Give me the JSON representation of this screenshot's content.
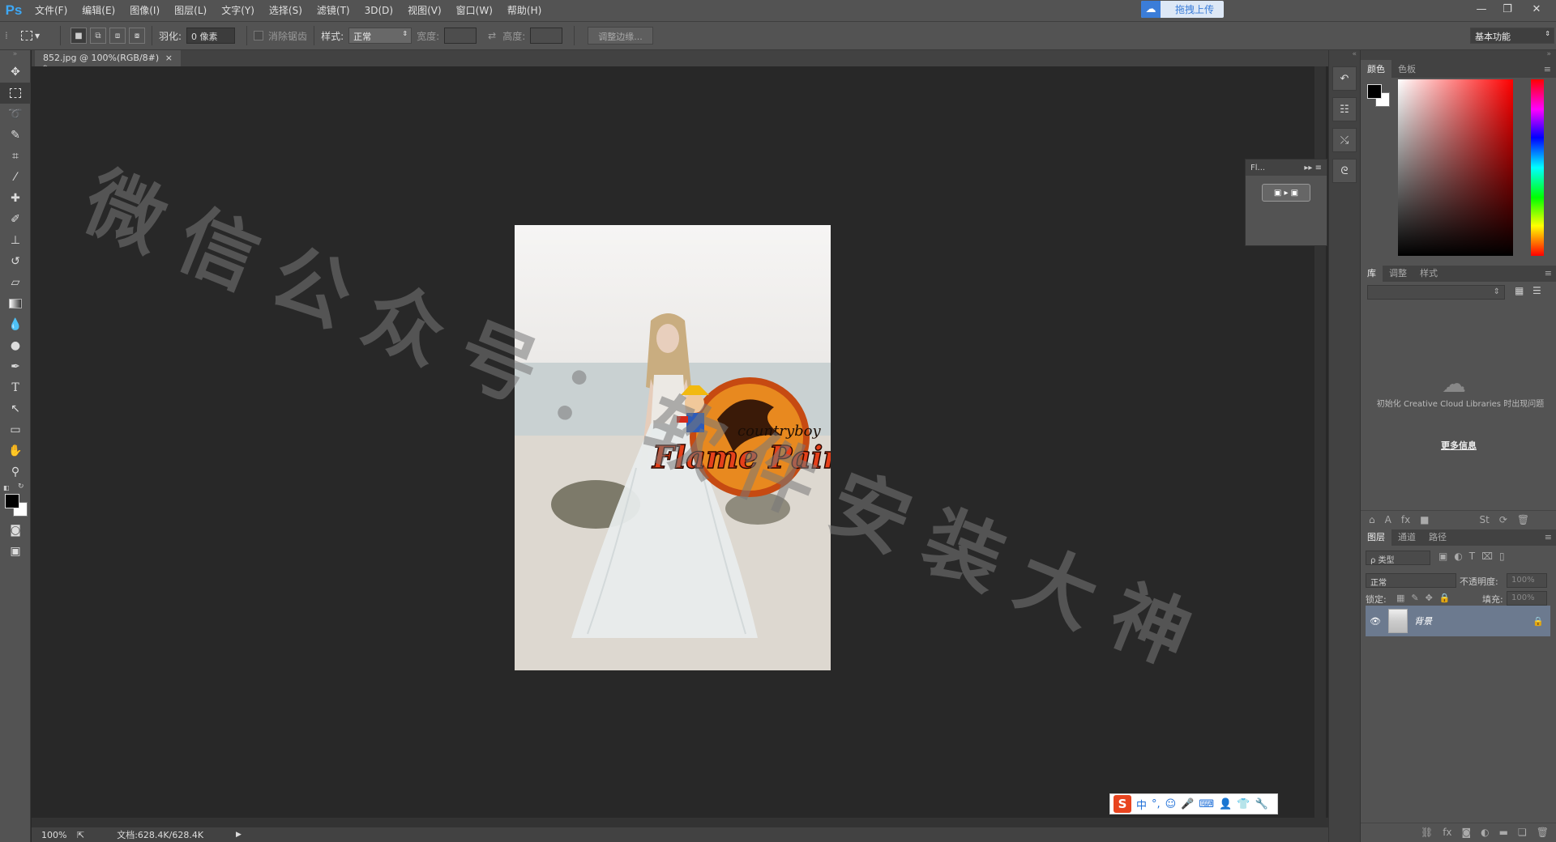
{
  "app": {
    "logo": "Ps"
  },
  "menu": [
    "文件(F)",
    "编辑(E)",
    "图像(I)",
    "图层(L)",
    "文字(Y)",
    "选择(S)",
    "滤镜(T)",
    "3D(D)",
    "视图(V)",
    "窗口(W)",
    "帮助(H)"
  ],
  "upload": {
    "label": "拖拽上传"
  },
  "options": {
    "feather_label": "羽化:",
    "feather_value": "0 像素",
    "antialias_label": "消除锯齿",
    "style_label": "样式:",
    "style_value": "正常",
    "width_label": "宽度:",
    "height_label": "高度:",
    "refine_label": "调整边缘...",
    "workspace": "基本功能"
  },
  "document": {
    "tab_title": "852.jpg @ 100%(RGB/8#) *"
  },
  "status": {
    "zoom": "100%",
    "doc_info": "文档:628.4K/628.4K"
  },
  "float_panel": {
    "title": "Fl..."
  },
  "color_panel": {
    "tabs": [
      "颜色",
      "色板"
    ]
  },
  "library_panel": {
    "tabs": [
      "库",
      "调整",
      "样式"
    ],
    "message": "初始化 Creative Cloud Libraries 时出现问题",
    "more_link": "更多信息"
  },
  "layers_panel": {
    "tabs": [
      "图层",
      "通道",
      "路径"
    ],
    "filter_label": "ρ 类型",
    "blend_mode": "正常",
    "opacity_label": "不透明度:",
    "opacity_value": "100%",
    "lock_label": "锁定:",
    "fill_label": "填充:",
    "fill_value": "100%",
    "layers": [
      {
        "name": "背景",
        "visible": true,
        "locked": true
      }
    ]
  },
  "artwork": {
    "logo_brand": "countryboy",
    "logo_title": "Flame Painter",
    "watermark": "微信公众号：软件安装大神"
  },
  "ime": {
    "chars": [
      "中",
      "°,"
    ]
  }
}
